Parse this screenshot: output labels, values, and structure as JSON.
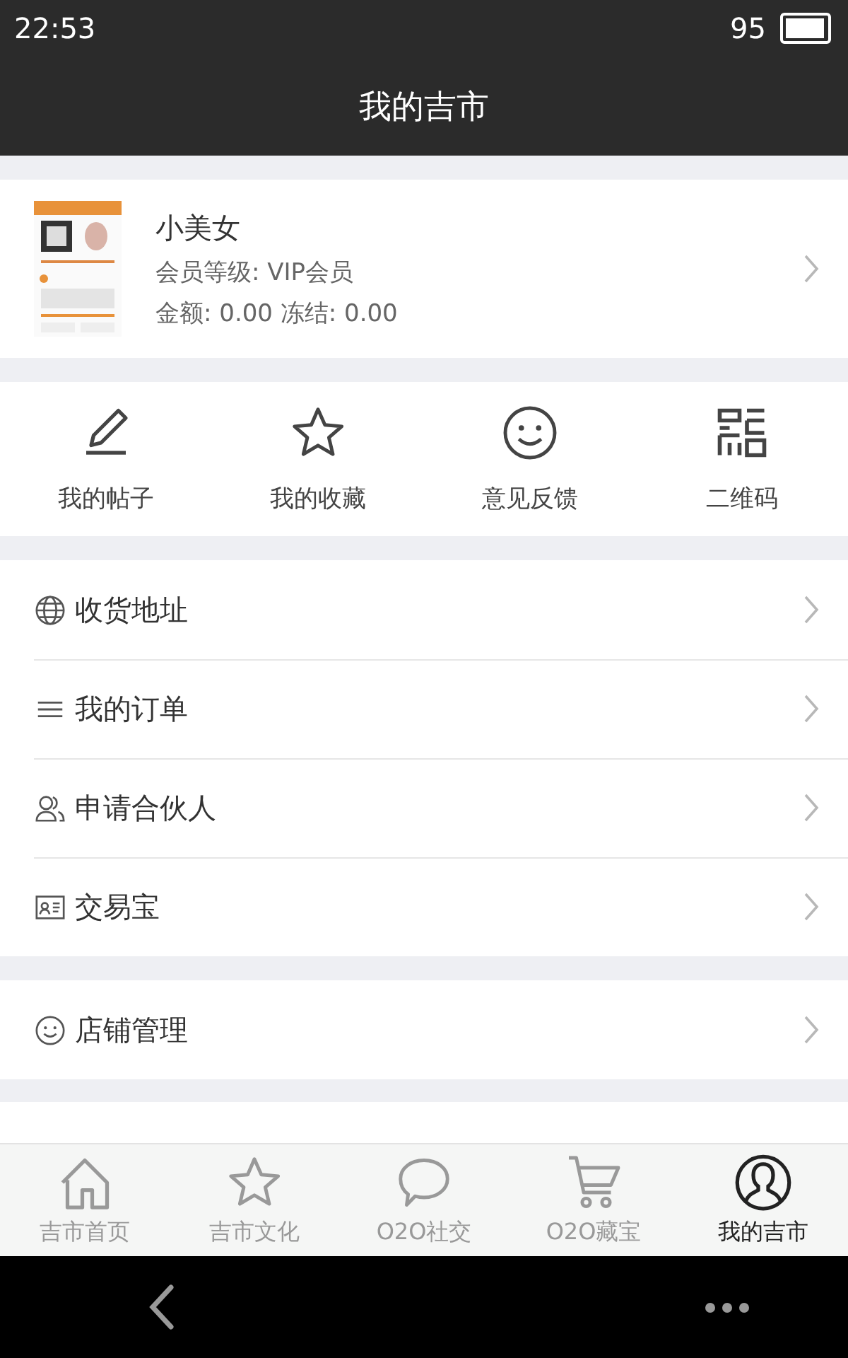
{
  "status_bar": {
    "time": "22:53",
    "battery": "95"
  },
  "header": {
    "title": "我的吉市"
  },
  "profile": {
    "name": "小美女",
    "level": "会员等级: VIP会员",
    "balance": "金额: 0.00 冻结: 0.00"
  },
  "shortcuts": [
    {
      "label": "我的帖子",
      "kind": "pencil"
    },
    {
      "label": "我的收藏",
      "kind": "star"
    },
    {
      "label": "意见反馈",
      "kind": "smile"
    },
    {
      "label": "二维码",
      "kind": "qr"
    }
  ],
  "menu_groups": [
    [
      {
        "label": "收货地址",
        "kind": "globe"
      },
      {
        "label": "我的订单",
        "kind": "lines"
      },
      {
        "label": "申请合伙人",
        "kind": "people"
      },
      {
        "label": "交易宝",
        "kind": "card"
      }
    ],
    [
      {
        "label": "店铺管理",
        "kind": "smile"
      }
    ]
  ],
  "tabs": [
    {
      "label": "吉市首页",
      "kind": "home",
      "selected": false
    },
    {
      "label": "吉市文化",
      "kind": "star",
      "selected": false
    },
    {
      "label": "O2O社交",
      "kind": "chat",
      "selected": false
    },
    {
      "label": "O2O藏宝",
      "kind": "cart",
      "selected": false
    },
    {
      "label": "我的吉市",
      "kind": "user",
      "selected": true
    }
  ]
}
